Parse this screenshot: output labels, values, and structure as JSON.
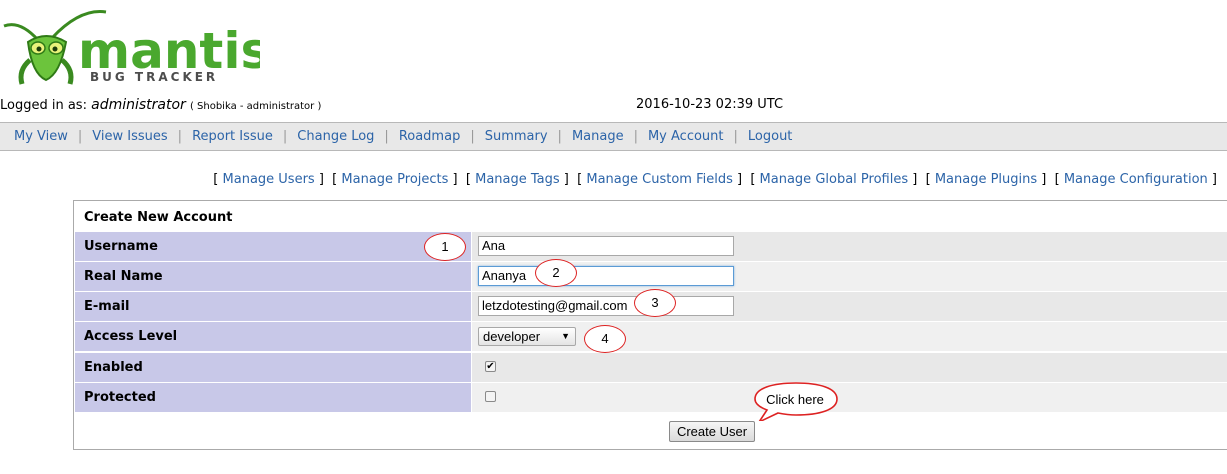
{
  "logo": {
    "word": "mantis",
    "tagline": "BUG TRACKER"
  },
  "header": {
    "logged_in_label": "Logged in as:",
    "username": "administrator",
    "user_detail": "( Shobika - administrator )",
    "datetime": "2016-10-23 02:39 UTC"
  },
  "menu": {
    "items": [
      {
        "label": "My View"
      },
      {
        "label": "View Issues"
      },
      {
        "label": "Report Issue"
      },
      {
        "label": "Change Log"
      },
      {
        "label": "Roadmap"
      },
      {
        "label": "Summary"
      },
      {
        "label": "Manage"
      },
      {
        "label": "My Account"
      },
      {
        "label": "Logout"
      }
    ]
  },
  "submenu": {
    "items": [
      {
        "label": "Manage Users"
      },
      {
        "label": "Manage Projects"
      },
      {
        "label": "Manage Tags"
      },
      {
        "label": "Manage Custom Fields"
      },
      {
        "label": "Manage Global Profiles"
      },
      {
        "label": "Manage Plugins"
      },
      {
        "label": "Manage Configuration"
      }
    ]
  },
  "form": {
    "title": "Create New Account",
    "fields": {
      "username": {
        "label": "Username",
        "value": "Ana"
      },
      "realname": {
        "label": "Real Name",
        "value": "Ananya"
      },
      "email": {
        "label": "E-mail",
        "value": "letzdotesting@gmail.com"
      },
      "access": {
        "label": "Access Level",
        "value": "developer"
      },
      "enabled": {
        "label": "Enabled",
        "checked": true,
        "mark": "✔"
      },
      "protected": {
        "label": "Protected",
        "checked": false
      }
    },
    "submit_label": "Create User"
  },
  "annotations": {
    "n1": "1",
    "n2": "2",
    "n3": "3",
    "n4": "4",
    "callout": "Click here",
    "color": "#dd2222"
  },
  "colors": {
    "link": "#2c64a8",
    "label_bg": "#c8c8e8",
    "menu_bg": "#e8e8e8",
    "logo_green": "#4aa82e"
  }
}
